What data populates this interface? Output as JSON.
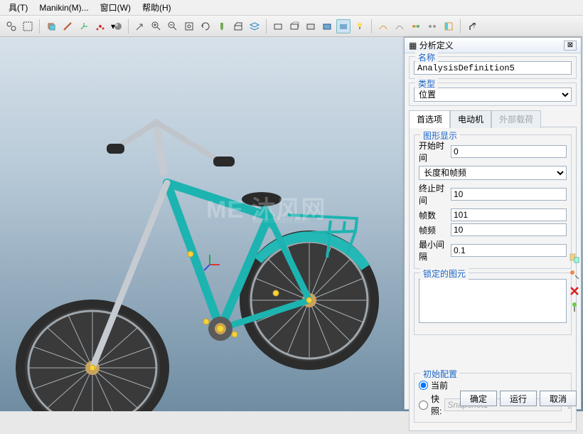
{
  "menu": {
    "items": [
      "具(T)",
      "Manikin(M)...",
      "窗口(W)",
      "帮助(H)"
    ]
  },
  "panel": {
    "title": "分析定义",
    "close_glyph": "⊠",
    "name_group": "名称",
    "name_value": "AnalysisDefinition5",
    "type_group": "类型",
    "type_value": "位置",
    "tabs": [
      "首选项",
      "电动机",
      "外部载荷"
    ],
    "graphic_display": "图形显示",
    "rows": {
      "start_time": {
        "label": "开始时间",
        "value": "0"
      },
      "length_fps": {
        "label": "",
        "value": "长度和帧频"
      },
      "end_time": {
        "label": "终止时间",
        "value": "10"
      },
      "frames": {
        "label": "帧数",
        "value": "101"
      },
      "fps": {
        "label": "帧频",
        "value": "10"
      },
      "min_int": {
        "label": "最小间隔",
        "value": "0.1"
      }
    },
    "locked_group": "锁定的图元",
    "initial_group": "初始配置",
    "radio_current": "当前",
    "radio_snapshot": "快照:",
    "snapshot_placeholder": "Snapshot1",
    "ok": "确定",
    "run": "运行",
    "cancel": "取消"
  },
  "watermark": "ME 沐风网",
  "watermark_sub": "www.mfans.com"
}
